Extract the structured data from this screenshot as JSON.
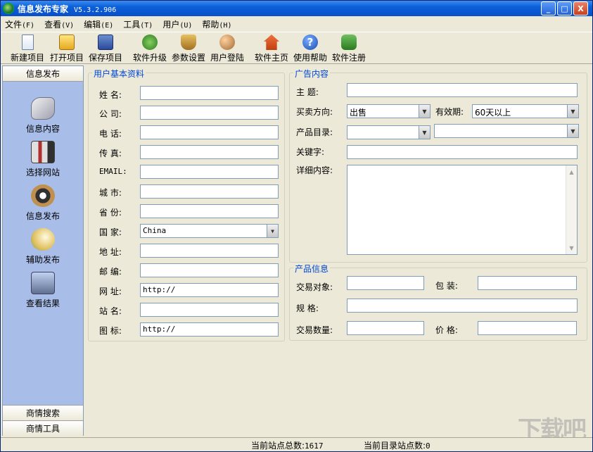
{
  "window": {
    "title": "信息发布专家",
    "version": "V5.3.2.906",
    "min_label": "_",
    "max_label": "□",
    "close_label": "X"
  },
  "menu": [
    {
      "label": "文件",
      "acc": "(F)"
    },
    {
      "label": "查看",
      "acc": "(V)"
    },
    {
      "label": "编辑",
      "acc": "(E)"
    },
    {
      "label": "工具",
      "acc": "(T)"
    },
    {
      "label": "用户",
      "acc": "(U)"
    },
    {
      "label": "帮助",
      "acc": "(H)"
    }
  ],
  "toolbar": [
    {
      "label": "新建项目",
      "icon": "new-document-icon"
    },
    {
      "label": "打开项目",
      "icon": "open-folder-icon"
    },
    {
      "label": "保存项目",
      "icon": "save-disk-icon"
    },
    {
      "label": "软件升级",
      "icon": "upgrade-globe-icon"
    },
    {
      "label": "参数设置",
      "icon": "settings-icon"
    },
    {
      "label": "用户登陆",
      "icon": "user-login-icon"
    },
    {
      "label": "软件主页",
      "icon": "home-icon"
    },
    {
      "label": "使用帮助",
      "icon": "help-icon",
      "glyph": "?"
    },
    {
      "label": "软件注册",
      "icon": "register-icon"
    }
  ],
  "sidebar": {
    "header": "信息发布",
    "items": [
      {
        "label": "信息内容",
        "icon": "scroll-icon"
      },
      {
        "label": "选择网站",
        "icon": "books-check-icon"
      },
      {
        "label": "信息发布",
        "icon": "camera-icon"
      },
      {
        "label": "辅助发布",
        "icon": "document-globe-icon"
      },
      {
        "label": "查看结果",
        "icon": "computer-icon"
      }
    ],
    "footer": [
      "商情搜索",
      "商情工具"
    ]
  },
  "user_info": {
    "title": "用户基本资料",
    "fields": [
      {
        "label": "姓  名:",
        "value": ""
      },
      {
        "label": "公  司:",
        "value": ""
      },
      {
        "label": "电  话:",
        "value": ""
      },
      {
        "label": "传  真:",
        "value": ""
      },
      {
        "label": "EMAIL:",
        "value": ""
      },
      {
        "label": "城  市:",
        "value": ""
      },
      {
        "label": "省  份:",
        "value": ""
      },
      {
        "label": "国  家:",
        "value": "China"
      },
      {
        "label": "地  址:",
        "value": ""
      },
      {
        "label": "邮  编:",
        "value": ""
      },
      {
        "label": "网  址:",
        "value": "http://"
      },
      {
        "label": "站  名:",
        "value": ""
      },
      {
        "label": "图  标:",
        "value": "http://"
      }
    ]
  },
  "ad_content": {
    "title": "广告内容",
    "subject_label": "主    题:",
    "subject_value": "",
    "direction_label": "买卖方向:",
    "direction_value": "出售",
    "validity_label": "有效期:",
    "validity_value": "60天以上",
    "catalog_label": "产品目录:",
    "catalog_value": "",
    "catalog2_value": "",
    "keyword_label": "关键字:",
    "keyword_value": "",
    "detail_label": "详细内容:",
    "detail_value": ""
  },
  "product_info": {
    "title": "产品信息",
    "target_label": "交易对象:",
    "target_value": "",
    "package_label": "包    装:",
    "package_value": "",
    "spec_label": "规    格:",
    "spec_value": "",
    "qty_label": "交易数量:",
    "qty_value": "",
    "price_label": "价    格:",
    "price_value": ""
  },
  "status": {
    "sites_label": "当前站点总数:",
    "sites_value": "1617",
    "catalog_label": "当前目录站点数:",
    "catalog_value": "0"
  },
  "watermark": "下载吧"
}
